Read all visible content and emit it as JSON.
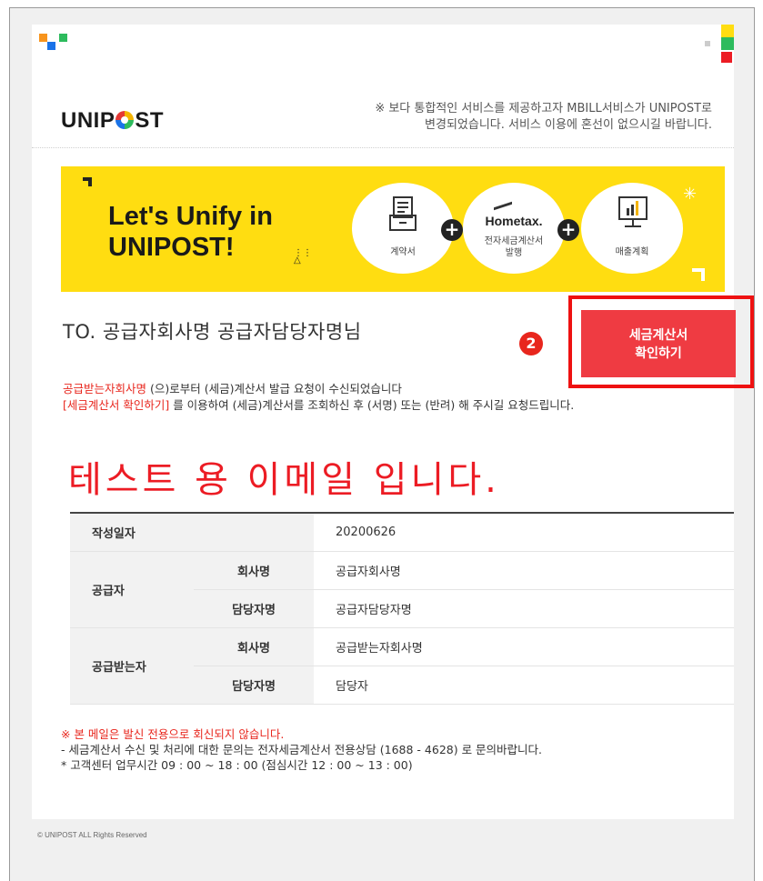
{
  "header": {
    "logo_text": "UNIPOST",
    "notice_line1": "※ 보다 통합적인 서비스를 제공하고자 MBILL서비스가 UNIPOST로",
    "notice_line2": "변경되었습니다. 서비스 이용에 혼선이 없으시길 바랍니다."
  },
  "banner": {
    "title_line1": "Let's Unify in",
    "title_line2": "UNIPOST!",
    "item1_label": "계약서",
    "item2_logo": "Hometax.",
    "item2_label_line1": "전자세금계산서",
    "item2_label_line2": "발행",
    "item3_label": "매출계획",
    "icon_names": [
      "contract-icon",
      "hometax-logo",
      "sales-chart-icon"
    ]
  },
  "recipient": {
    "to_line": "TO. 공급자회사명 공급자담당자명님",
    "step_badge": "2"
  },
  "confirm_button": {
    "label": "세금계산서\n확인하기",
    "color": "#ef3b42"
  },
  "message": {
    "line1_red": "공급받는자회사명",
    "line1_rest": " (으)로부터 (세금)계산서 발급 요청이 수신되었습니다",
    "line2_red": "[세금계산서 확인하기]",
    "line2_rest": " 를 이용하여 (세금)계산서를 조회하신 후 (서명) 또는 (반려) 해 주시길 요청드립니다."
  },
  "big_title": "테스트 용 이메일 입니다.",
  "table": {
    "created_label": "작성일자",
    "created_value": "20200626",
    "supplier_label": "공급자",
    "supplier_company_label": "회사명",
    "supplier_company_value": "공급자회사명",
    "supplier_manager_label": "담당자명",
    "supplier_manager_value": "공급자담당자명",
    "buyer_label": "공급받는자",
    "buyer_company_label": "회사명",
    "buyer_company_value": "공급받는자회사명",
    "buyer_manager_label": "담당자명",
    "buyer_manager_value": "담당자"
  },
  "footer": {
    "warning": "※ 본 메일은 발신 전용으로 회신되지 않습니다.",
    "inquiry": "- 세금계산서 수신 및 처리에 대한 문의는 전자세금계산서 전용상담 (1688 - 4628) 로 문의바랍니다.",
    "hours": "* 고객센터 업무시간 09 : 00 ~ 18 : 00 (점심시간 12 : 00 ~ 13 : 00)",
    "copyright": "© UNIPOST ALL Rights Reserved"
  },
  "colors": {
    "accent_red": "#ec1c24",
    "banner_yellow": "#ffdd11"
  }
}
